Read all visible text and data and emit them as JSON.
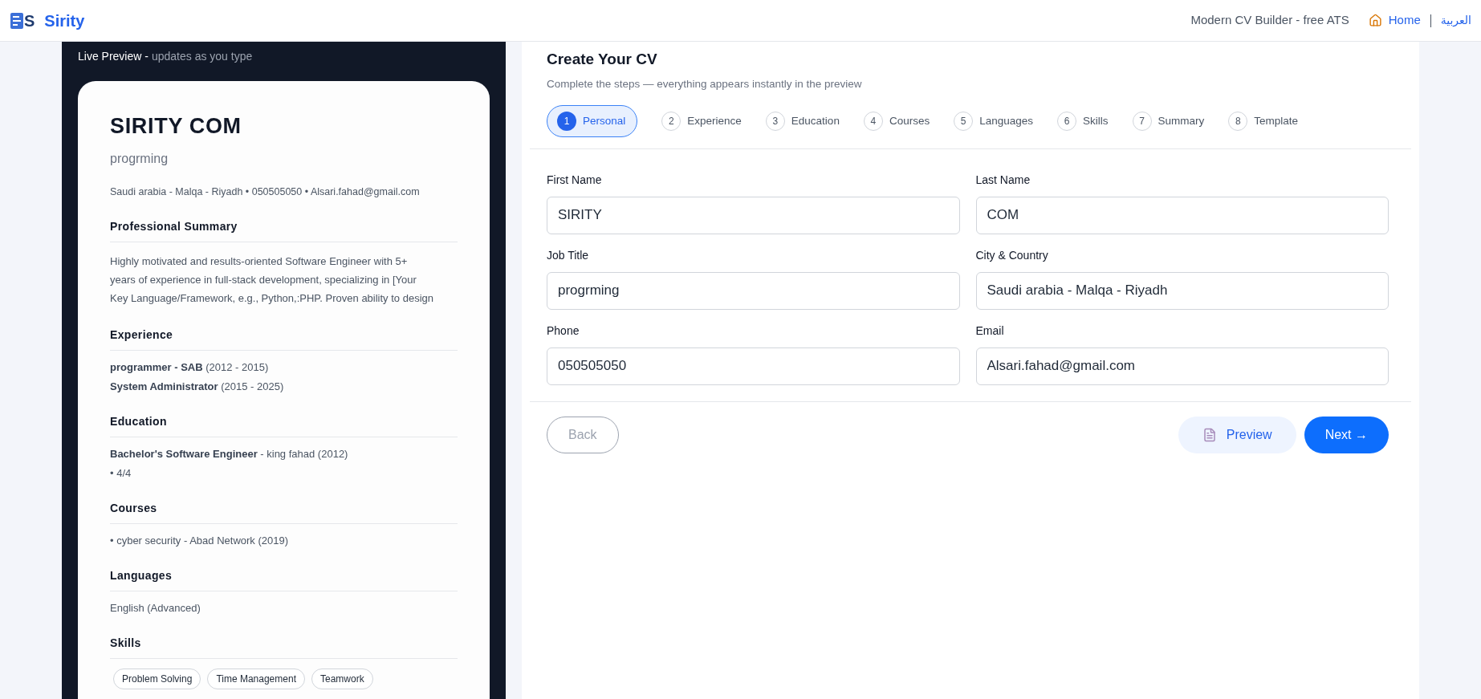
{
  "header": {
    "logo_letter": "S",
    "brand": "Sirity",
    "tagline": "Modern CV Builder - free ATS",
    "home_link": "Home",
    "language_link": "العربية"
  },
  "preview": {
    "title": "Live Preview -",
    "hint": "updates as you type",
    "cv": {
      "name": "SIRITY COM",
      "job_title": "progrming",
      "contact": "Saudi arabia - Malqa - Riyadh • 050505050 • Alsari.fahad@gmail.com",
      "sections": [
        {
          "kind": "paragraph",
          "heading": "Professional Summary",
          "lines": [
            "Highly motivated and results-oriented Software Engineer with 5+",
            "years of experience in full-stack development, specializing in [Your",
            "Key Language/Framework, e.g., Python,:PHP. Proven ability to design"
          ]
        },
        {
          "kind": "list",
          "heading": "Experience",
          "lines": [
            "**programmer - SAB** (2012 - 2015)",
            "**System Administrator** (2015 - 2025)"
          ]
        },
        {
          "kind": "list",
          "heading": "Education",
          "lines": [
            "**Bachelor's Software Engineer** - king fahad (2012)",
            "• 4/4"
          ]
        },
        {
          "kind": "list",
          "heading": "Courses",
          "lines": [
            "• cyber security - Abad Network (2019)"
          ]
        },
        {
          "kind": "list",
          "heading": "Languages",
          "lines": [
            "English (Advanced)"
          ]
        },
        {
          "kind": "tags",
          "heading": "Skills",
          "lines": [
            "Problem Solving",
            "Time Management",
            "Teamwork"
          ]
        }
      ]
    }
  },
  "form": {
    "title": "Create Your CV",
    "subtitle": "Complete the steps — everything appears instantly in the preview",
    "steps": [
      {
        "number": "1",
        "label": "Personal",
        "selected": true
      },
      {
        "number": "2",
        "label": "Experience",
        "selected": false
      },
      {
        "number": "3",
        "label": "Education",
        "selected": false
      },
      {
        "number": "4",
        "label": "Courses",
        "selected": false
      },
      {
        "number": "5",
        "label": "Languages",
        "selected": false
      },
      {
        "number": "6",
        "label": "Skills",
        "selected": false
      },
      {
        "number": "7",
        "label": "Summary",
        "selected": false
      },
      {
        "number": "8",
        "label": "Template",
        "selected": false
      }
    ],
    "fields": [
      {
        "label": "First Name",
        "value": "SIRITY"
      },
      {
        "label": "Last Name",
        "value": "COM"
      },
      {
        "label": "Job Title",
        "value": "progrming"
      },
      {
        "label": "City & Country",
        "value": "Saudi arabia - Malqa - Riyadh"
      },
      {
        "label": "Phone",
        "value": "050505050"
      },
      {
        "label": "Email",
        "value": "Alsari.fahad@gmail.com"
      }
    ],
    "back_button": {
      "label": "Back",
      "disabled": true
    },
    "preview_button": {
      "label": "Preview"
    },
    "next_button": {
      "label": "Next →"
    }
  }
}
